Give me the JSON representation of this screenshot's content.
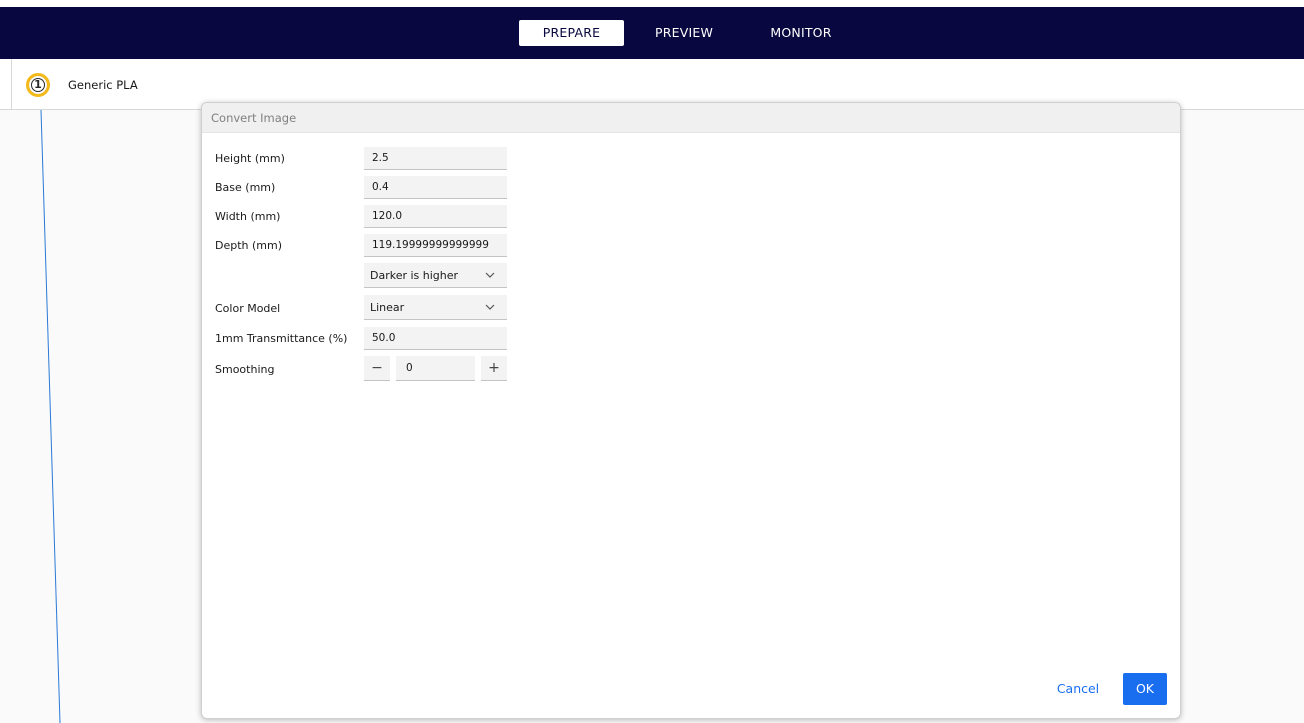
{
  "header": {
    "tabs": [
      {
        "label": "PREPARE",
        "active": true
      },
      {
        "label": "PREVIEW",
        "active": false
      },
      {
        "label": "MONITOR",
        "active": false
      }
    ],
    "background": "#08073f"
  },
  "toolbar": {
    "extruder_number": "1",
    "material": "Generic PLA",
    "extruder_color": "#f3ba1a"
  },
  "dialog": {
    "title": "Convert Image",
    "fields": {
      "height": {
        "label": "Height (mm)",
        "value": "2.5"
      },
      "base": {
        "label": "Base (mm)",
        "value": "0.4"
      },
      "width": {
        "label": "Width (mm)",
        "value": "120.0"
      },
      "depth": {
        "label": "Depth (mm)",
        "value": "119.19999999999999"
      },
      "lighter_darker": {
        "selected": "Darker is higher"
      },
      "color_model": {
        "label": "Color Model",
        "selected": "Linear"
      },
      "transmittance": {
        "label": "1mm Transmittance (%)",
        "value": "50.0"
      },
      "smoothing": {
        "label": "Smoothing",
        "value": "0",
        "minus": "−",
        "plus": "+"
      }
    },
    "buttons": {
      "cancel": "Cancel",
      "ok": "OK"
    },
    "accent_color": "#196ef0"
  }
}
